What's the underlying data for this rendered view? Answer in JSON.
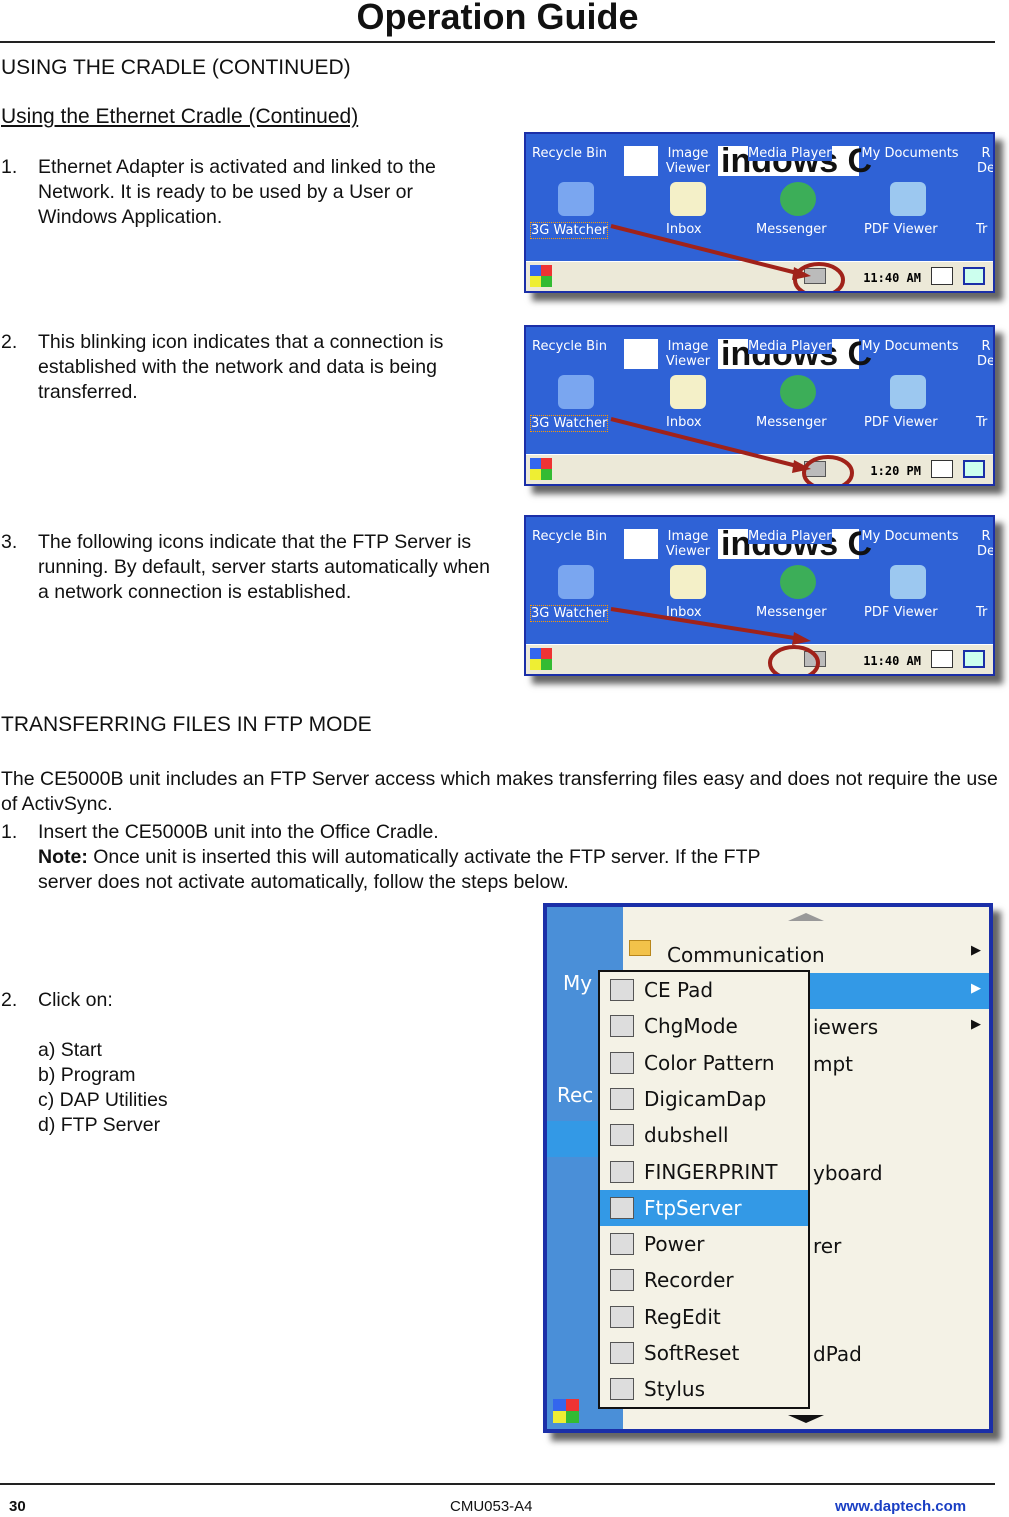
{
  "header": {
    "title": "Operation Guide"
  },
  "section1": {
    "heading": "USING THE CRADLE (CONTINUED)",
    "subheading": "Using the Ethernet Cradle (Continued)"
  },
  "steps": [
    {
      "num": "1.",
      "text": "Ethernet Adapter is activated and linked to the Network. It is ready to be used by a User or Windows Application."
    },
    {
      "num": "2.",
      "text": "This blinking icon indicates that a connection is established with the network and data is being transferred."
    },
    {
      "num": "3.",
      "text": "The following icons indicate that the FTP Server is running. By default, server starts automatically when a network connection is established."
    }
  ],
  "screens": [
    {
      "time": "11:40 AM",
      "status_icon": "network-adapter-icon"
    },
    {
      "time": "1:20 PM",
      "status_icon": "network-transfer-icon"
    },
    {
      "time": "11:40 AM",
      "status_icon": "ftp-server-icon"
    }
  ],
  "desktop": {
    "recycle": "Recycle Bin",
    "image_viewer": "Image Viewer",
    "media_player": "Media Player",
    "my_documents": "My Documents",
    "partial_right": "R De",
    "watcher": "3G Watcher",
    "inbox": "Inbox",
    "messenger": "Messenger",
    "pdf": "PDF Viewer",
    "partial_tr": "Tr",
    "logo_text": "indows C"
  },
  "section2": {
    "heading": "TRANSFERRING FILES IN FTP MODE",
    "intro": "The CE5000B unit includes an FTP Server access which makes transferring files easy and does not require the use of ActivSync.",
    "step1_num": "1.",
    "step1": "Insert the CE5000B unit into the Office Cradle.",
    "note_label": "Note:",
    "note": " Once unit is inserted this will automatically activate the FTP server. If the FTP server does not activate automatically, follow the steps below.",
    "step2_num": "2.",
    "step2": "Click on:",
    "substeps": [
      "a) Start",
      "b) Program",
      "c) DAP Utilities",
      "d) FTP Server"
    ]
  },
  "menu": {
    "left": [
      "My",
      "Rec"
    ],
    "main": [
      "Communication",
      "iewers",
      "mpt",
      "yboard",
      "rer",
      "dPad"
    ],
    "submenu": [
      "CE Pad",
      "ChgMode",
      "Color Pattern",
      "DigicamDap",
      "dubshell",
      "FINGERPRINT",
      "FtpServer",
      "Power",
      "Recorder",
      "RegEdit",
      "SoftReset",
      "Stylus"
    ],
    "selected": "FtpServer"
  },
  "colors": {
    "desktop": "#2f62d6",
    "highlight": "#3399e6",
    "arrow": "#a0221a",
    "link": "#1a3fc4"
  },
  "footer": {
    "page": "30",
    "doc": "CMU053-A4",
    "url": "www.daptech.com"
  }
}
